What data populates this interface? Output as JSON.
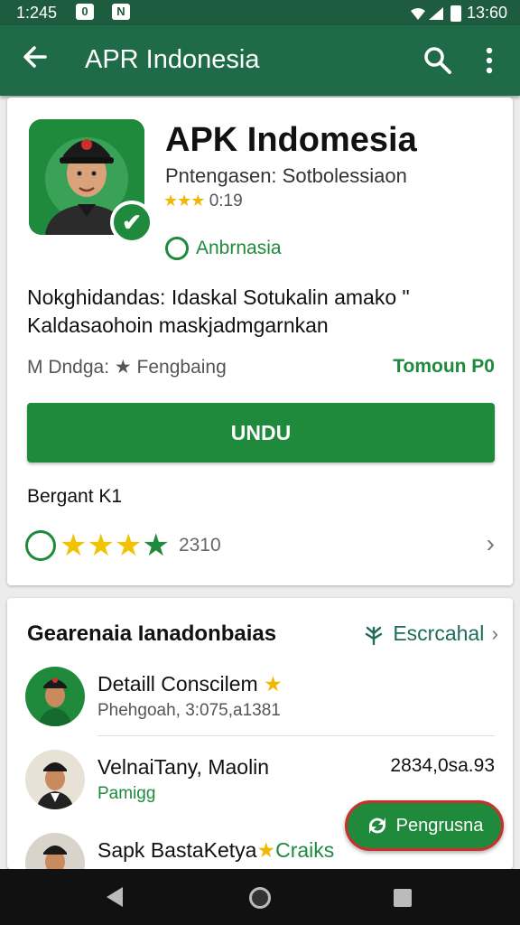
{
  "status_bar": {
    "time": "1:245",
    "notification_1": "0",
    "notification_2": "N",
    "right_time": "13:60"
  },
  "app_bar": {
    "title": "APR Indonesia"
  },
  "app": {
    "name": "APK Indomesia",
    "developer": "Pntengasen: Sotbolessiaon",
    "stars": "★★★",
    "rating": "0:19",
    "tag": "Anbrnasia",
    "description": "Nokghidandas: Idaskal Sotukalin amako \" Kaldasaohoin maskjadmgarnkan",
    "meta_left": "M Dndga: ★ Fengbaing",
    "meta_right": "Tomoun P0",
    "install_label": "UNDU"
  },
  "reviews": {
    "label": "Bergant K1",
    "stars": "★★★★",
    "count": "2310",
    "colors": {
      "gold": "#f2c204",
      "green": "#1e8a3c"
    }
  },
  "section": {
    "title": "Gearenaia Ianadonbaias",
    "link_label": "Escrcahal",
    "items": [
      {
        "name": "Detaill Conscilem",
        "star": "★",
        "sub": "Phehgoah, 3:075,a1381",
        "price": ""
      },
      {
        "name": "VelnaiTany, Maolin",
        "star": "",
        "sub": "Pamigg",
        "price": "2834,0sa.93"
      },
      {
        "name": "Sapk BastaKetya",
        "star": "★",
        "sub": "Craiks",
        "price": ""
      }
    ]
  },
  "fab": {
    "label": "Pengrusna"
  },
  "theme": {
    "primary": "#1f6b48",
    "accent": "#1f8a3c",
    "star": "#f2b705"
  }
}
